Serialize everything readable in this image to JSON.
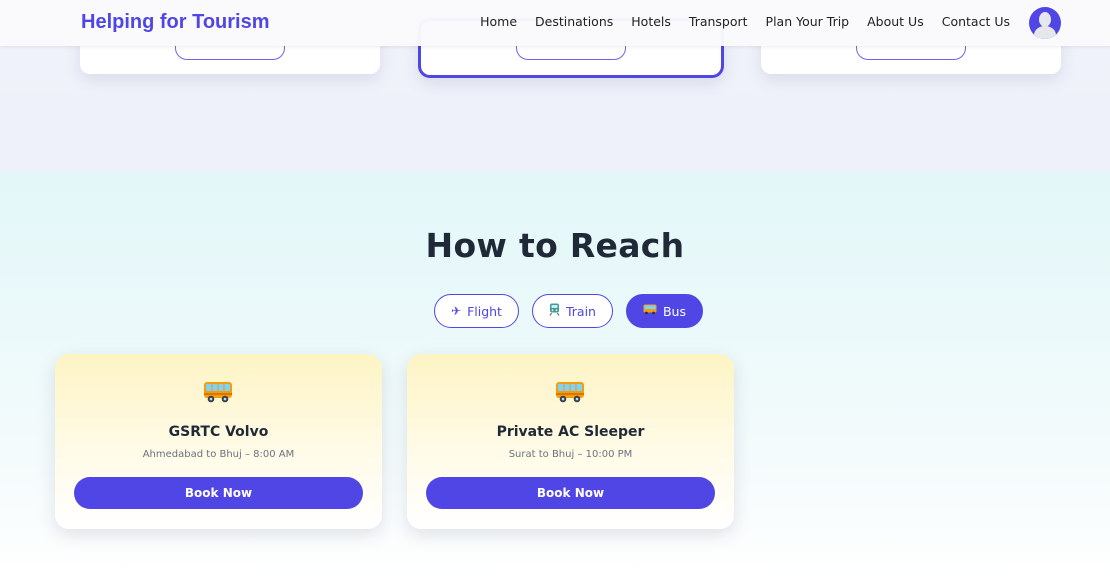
{
  "header": {
    "brand": "Helping for Tourism",
    "nav": [
      "Home",
      "Destinations",
      "Hotels",
      "Transport",
      "Plan Your Trip",
      "About Us",
      "Contact Us"
    ]
  },
  "reach": {
    "title": "How to Reach",
    "tabs": [
      {
        "label": "Flight",
        "icon": "airplane-icon",
        "active": false
      },
      {
        "label": "Train",
        "icon": "train-icon",
        "active": false
      },
      {
        "label": "Bus",
        "icon": "bus-icon",
        "active": true
      }
    ],
    "cards": [
      {
        "title": "GSRTC Volvo",
        "route": "Ahmedabad to Bhuj – 8:00 AM",
        "button": "Book Now"
      },
      {
        "title": "Private AC Sleeper",
        "route": "Surat to Bhuj – 10:00 PM",
        "button": "Book Now"
      }
    ]
  },
  "colors": {
    "accent": "#4f46e5",
    "card_gradient_top": "#fdf4c4"
  }
}
